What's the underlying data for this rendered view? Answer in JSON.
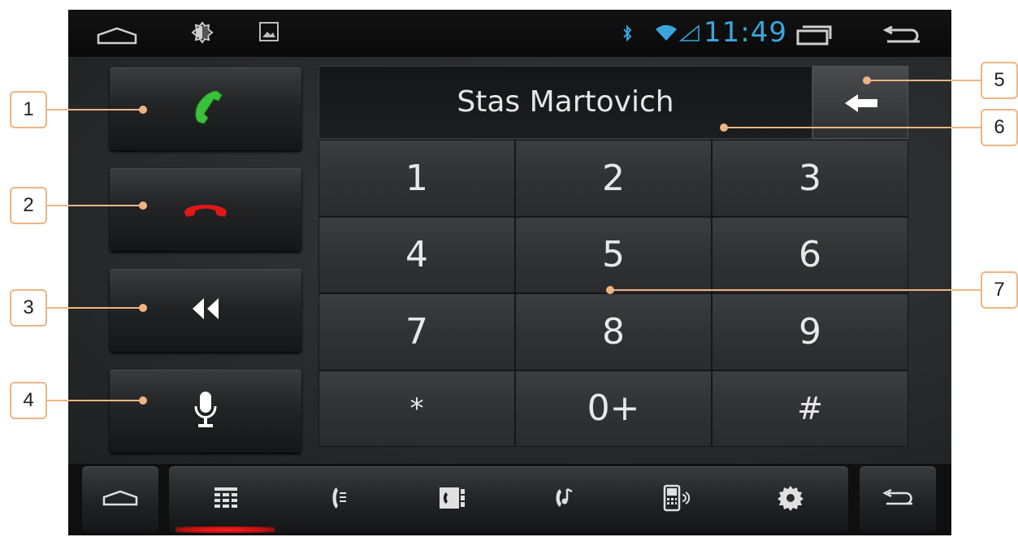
{
  "statusbar": {
    "time": "11:49",
    "icons": [
      "home-outline-icon",
      "brightness-icon",
      "gallery-icon",
      "bluetooth-icon",
      "wifi-icon",
      "signal-icon",
      "recent-apps-icon",
      "back-arrow-icon"
    ]
  },
  "display": {
    "text": "Stas Martovich"
  },
  "side_buttons": [
    {
      "id": "call",
      "icon": "phone-call-icon",
      "color": "#39c23a"
    },
    {
      "id": "hangup",
      "icon": "phone-hangup-icon",
      "color": "#e01818"
    },
    {
      "id": "speaker",
      "icon": "speaker-icon"
    },
    {
      "id": "mic",
      "icon": "microphone-icon"
    }
  ],
  "keypad": {
    "keys": [
      "1",
      "2",
      "3",
      "4",
      "5",
      "6",
      "7",
      "8",
      "9",
      "*",
      "0+",
      "#"
    ]
  },
  "bottom_tabs": [
    {
      "icon": "keypad-icon",
      "active": true
    },
    {
      "icon": "call-log-icon"
    },
    {
      "icon": "contacts-book-icon"
    },
    {
      "icon": "music-phone-icon"
    },
    {
      "icon": "phone-signal-icon"
    },
    {
      "icon": "settings-gear-icon"
    }
  ],
  "callouts": [
    "1",
    "2",
    "3",
    "4",
    "5",
    "6",
    "7"
  ],
  "colors": {
    "accent_blue": "#3aa6dd",
    "callout": "#f0b483",
    "active_tab": "#e01818"
  }
}
